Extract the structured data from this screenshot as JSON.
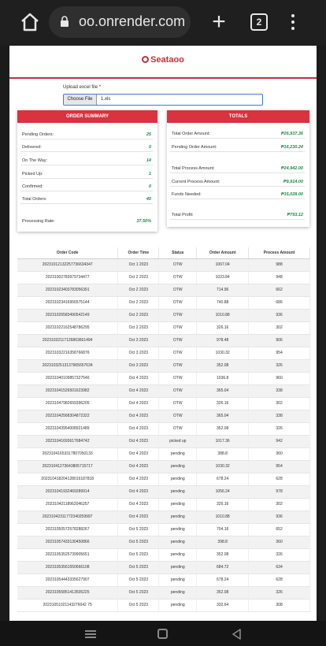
{
  "browser": {
    "url": "oo.onrender.com",
    "tab_count": "2"
  },
  "brand": {
    "name": "Seataoo",
    "color": "#c62f3b"
  },
  "upload": {
    "label": "Upload excel file *",
    "choose_label": "Choose File",
    "file_name": "1.xls"
  },
  "order_summary": {
    "title": "ORDER SUMMARY",
    "items": [
      {
        "label": "Pending Orders:",
        "value": "25"
      },
      {
        "label": "Delivered:",
        "value": "0"
      },
      {
        "label": "On The Way:",
        "value": "14"
      },
      {
        "label": "Picked Up:",
        "value": "1"
      },
      {
        "label": "Confirmed:",
        "value": "0"
      },
      {
        "label": "Total Orders:",
        "value": "40"
      }
    ],
    "processing_label": "Processing Rate:",
    "processing_value": "37.50%"
  },
  "totals": {
    "title": "TOTALS",
    "items": [
      {
        "label": "Total Order Amount:",
        "value": "₱26,937.36"
      },
      {
        "label": "Pending Order Amount:",
        "value": "₱16,230.24"
      },
      {
        "label": "Total Process Amount:",
        "value": "₱24,942.00"
      },
      {
        "label": "Current Process Amount:",
        "value": "₱9,914.00"
      },
      {
        "label": "Funds Needed:",
        "value": "₱15,028.00"
      },
      {
        "label": "Total Profit:",
        "value": "₱793.12"
      }
    ]
  },
  "table": {
    "headers": [
      "Order Code",
      "Order Time",
      "Status",
      "Order Amount",
      "Process Amount"
    ],
    "rows": [
      [
        "20231012132257736634347",
        "Oct 1 2023",
        "OTW",
        "1067.04",
        "988"
      ],
      [
        "20231002783979734477",
        "Oct 2 2023",
        "OTW",
        "1023.84",
        "948"
      ],
      [
        "20231023403783056391",
        "Oct 2 2023",
        "OTW",
        "714.96",
        "662"
      ],
      [
        "20231023416956575144",
        "Oct 2 2023",
        "OTW",
        "740.88",
        "686"
      ],
      [
        "20231026583490542149",
        "Oct 2 2023",
        "OTW",
        "1010.88",
        "936"
      ],
      [
        "20231022162548786295",
        "Oct 2 2023",
        "OTW",
        "326.16",
        "302"
      ],
      [
        "20231032117126863661494",
        "Oct 3 2023",
        "OTW",
        "978.48",
        "906"
      ],
      [
        "20231032216358766876",
        "Oct 3 2023",
        "OTW",
        "1030.32",
        "954"
      ],
      [
        "20231032513137965657634",
        "Oct 3 2023",
        "OTW",
        "352.08",
        "326"
      ],
      [
        "20231040109857327546",
        "Oct 4 2023",
        "OTW",
        "1036.8",
        "960"
      ],
      [
        "20231041526501623982",
        "Oct 4 2023",
        "OTW",
        "365.04",
        "338"
      ],
      [
        "20231047982659396205",
        "Oct 4 2023",
        "OTW",
        "326.16",
        "302"
      ],
      [
        "20231042568304872322",
        "Oct 4 2023",
        "OTW",
        "365.04",
        "338"
      ],
      [
        "20231043954008921489",
        "Oct 4 2023",
        "OTW",
        "352.08",
        "326"
      ],
      [
        "20231041693617684742",
        "Oct 4 2023",
        "picked up",
        "1017.36",
        "942"
      ],
      [
        "20231041653317807050133",
        "Oct 4 2023",
        "pending",
        "388.8",
        "360"
      ],
      [
        "20231041273643805715717",
        "Oct 4 2023",
        "pending",
        "1030.32",
        "954"
      ],
      [
        "202310418204128016187818",
        "Oct 4 2023",
        "pending",
        "678.24",
        "628"
      ],
      [
        "20231041932469289914",
        "Oct 4 2023",
        "pending",
        "1056.24",
        "978"
      ],
      [
        "20231042118962046257",
        "Oct 4 2023",
        "pending",
        "326.16",
        "302"
      ],
      [
        "20231042311772340259997",
        "Oct 4 2023",
        "pending",
        "1010.88",
        "936"
      ],
      [
        "20231050572578288267",
        "Oct 5 2023",
        "pending",
        "704.16",
        "652"
      ],
      [
        "20231057433130450866",
        "Oct 5 2023",
        "pending",
        "398.8",
        "360"
      ],
      [
        "20231053525739905651",
        "Oct 5 2023",
        "pending",
        "352.08",
        "326"
      ],
      [
        "20231053561550666108",
        "Oct 5 2023",
        "pending",
        "684.72",
        "634"
      ],
      [
        "20231054443335627907",
        "Oct 5 2023",
        "pending",
        "678.24",
        "628"
      ],
      [
        "20231055851413505225",
        "Oct 5 2023",
        "pending",
        "352.08",
        "326"
      ],
      [
        "20231051021143276042 75",
        "Oct 5 2023",
        "pending",
        "332.64",
        "308"
      ]
    ]
  }
}
